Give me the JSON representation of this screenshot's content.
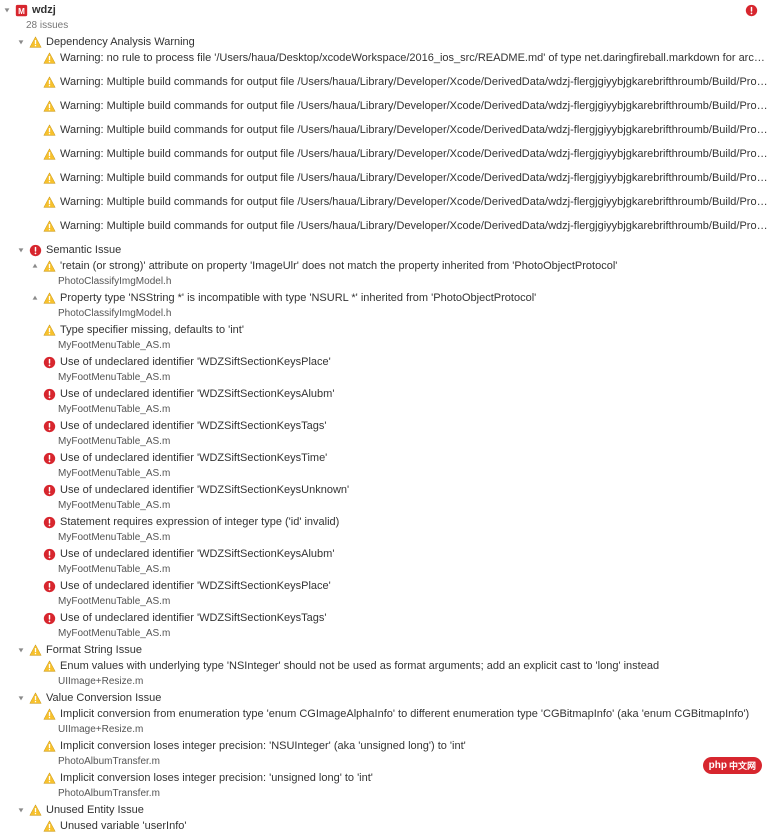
{
  "project": {
    "name": "wdzj",
    "issue_count": "28 issues"
  },
  "sections": {
    "dependency": {
      "title": "Dependency Analysis Warning",
      "items": [
        "Warning: no rule to process file '/Users/haua/Desktop/xcodeWorkspace/2016_ios_src/README.md' of type net.daringfireball.markdown for architectur…",
        "Warning: Multiple build commands for output file /Users/haua/Library/Developer/Xcode/DerivedData/wdzj-flergjgiyybjgkarebrifthroumb/Build/Product…",
        "Warning: Multiple build commands for output file /Users/haua/Library/Developer/Xcode/DerivedData/wdzj-flergjgiyybjgkarebrifthroumb/Build/Product…",
        "Warning: Multiple build commands for output file /Users/haua/Library/Developer/Xcode/DerivedData/wdzj-flergjgiyybjgkarebrifthroumb/Build/Product…",
        "Warning: Multiple build commands for output file /Users/haua/Library/Developer/Xcode/DerivedData/wdzj-flergjgiyybjgkarebrifthroumb/Build/Product…",
        "Warning: Multiple build commands for output file /Users/haua/Library/Developer/Xcode/DerivedData/wdzj-flergjgiyybjgkarebrifthroumb/Build/Product…",
        "Warning: Multiple build commands for output file /Users/haua/Library/Developer/Xcode/DerivedData/wdzj-flergjgiyybjgkarebrifthroumb/Build/Product…",
        "Warning: Multiple build commands for output file /Users/haua/Library/Developer/Xcode/DerivedData/wdzj-flergjgiyybjgkarebrifthroumb/Build/Product…"
      ]
    },
    "semantic": {
      "title": "Semantic Issue",
      "items": [
        {
          "type": "warning",
          "disclosure": true,
          "text": "'retain (or strong)' attribute on property 'ImageUlr' does not match the property inherited from 'PhotoObjectProtocol'",
          "file": "PhotoClassifyImgModel.h"
        },
        {
          "type": "warning",
          "disclosure": true,
          "text": "Property type 'NSString *' is incompatible with type 'NSURL *' inherited from 'PhotoObjectProtocol'",
          "file": "PhotoClassifyImgModel.h"
        },
        {
          "type": "warning",
          "disclosure": false,
          "text": "Type specifier missing, defaults to 'int'",
          "file": "MyFootMenuTable_AS.m"
        },
        {
          "type": "error",
          "disclosure": false,
          "text": "Use of undeclared identifier 'WDZSiftSectionKeysPlace'",
          "file": "MyFootMenuTable_AS.m"
        },
        {
          "type": "error",
          "disclosure": false,
          "text": "Use of undeclared identifier 'WDZSiftSectionKeysAlubm'",
          "file": "MyFootMenuTable_AS.m"
        },
        {
          "type": "error",
          "disclosure": false,
          "text": "Use of undeclared identifier 'WDZSiftSectionKeysTags'",
          "file": "MyFootMenuTable_AS.m"
        },
        {
          "type": "error",
          "disclosure": false,
          "text": "Use of undeclared identifier 'WDZSiftSectionKeysTime'",
          "file": "MyFootMenuTable_AS.m"
        },
        {
          "type": "error",
          "disclosure": false,
          "text": "Use of undeclared identifier 'WDZSiftSectionKeysUnknown'",
          "file": "MyFootMenuTable_AS.m"
        },
        {
          "type": "error",
          "disclosure": false,
          "text": "Statement requires expression of integer type ('id' invalid)",
          "file": "MyFootMenuTable_AS.m"
        },
        {
          "type": "error",
          "disclosure": false,
          "text": "Use of undeclared identifier 'WDZSiftSectionKeysAlubm'",
          "file": "MyFootMenuTable_AS.m"
        },
        {
          "type": "error",
          "disclosure": false,
          "text": "Use of undeclared identifier 'WDZSiftSectionKeysPlace'",
          "file": "MyFootMenuTable_AS.m"
        },
        {
          "type": "error",
          "disclosure": false,
          "text": "Use of undeclared identifier 'WDZSiftSectionKeysTags'",
          "file": "MyFootMenuTable_AS.m"
        }
      ]
    },
    "format": {
      "title": "Format String Issue",
      "items": [
        {
          "type": "warning",
          "text": "Enum values with underlying type 'NSInteger' should not be used as format arguments; add an explicit cast to 'long' instead",
          "file": "UIImage+Resize.m"
        }
      ]
    },
    "conversion": {
      "title": "Value Conversion Issue",
      "items": [
        {
          "type": "warning",
          "text": "Implicit conversion from enumeration type 'enum CGImageAlphaInfo' to different enumeration type 'CGBitmapInfo' (aka 'enum CGBitmapInfo')",
          "file": "UIImage+Resize.m"
        },
        {
          "type": "warning",
          "text": "Implicit conversion loses integer precision: 'NSUInteger' (aka 'unsigned long') to 'int'",
          "file": "PhotoAlbumTransfer.m"
        },
        {
          "type": "warning",
          "text": "Implicit conversion loses integer precision: 'unsigned long' to 'int'",
          "file": "PhotoAlbumTransfer.m"
        }
      ]
    },
    "unused": {
      "title": "Unused Entity Issue",
      "items": [
        {
          "type": "warning",
          "text": "Unused variable 'userInfo'",
          "file": ""
        }
      ]
    }
  },
  "logo": {
    "text": "php",
    "cn": "中文网"
  }
}
